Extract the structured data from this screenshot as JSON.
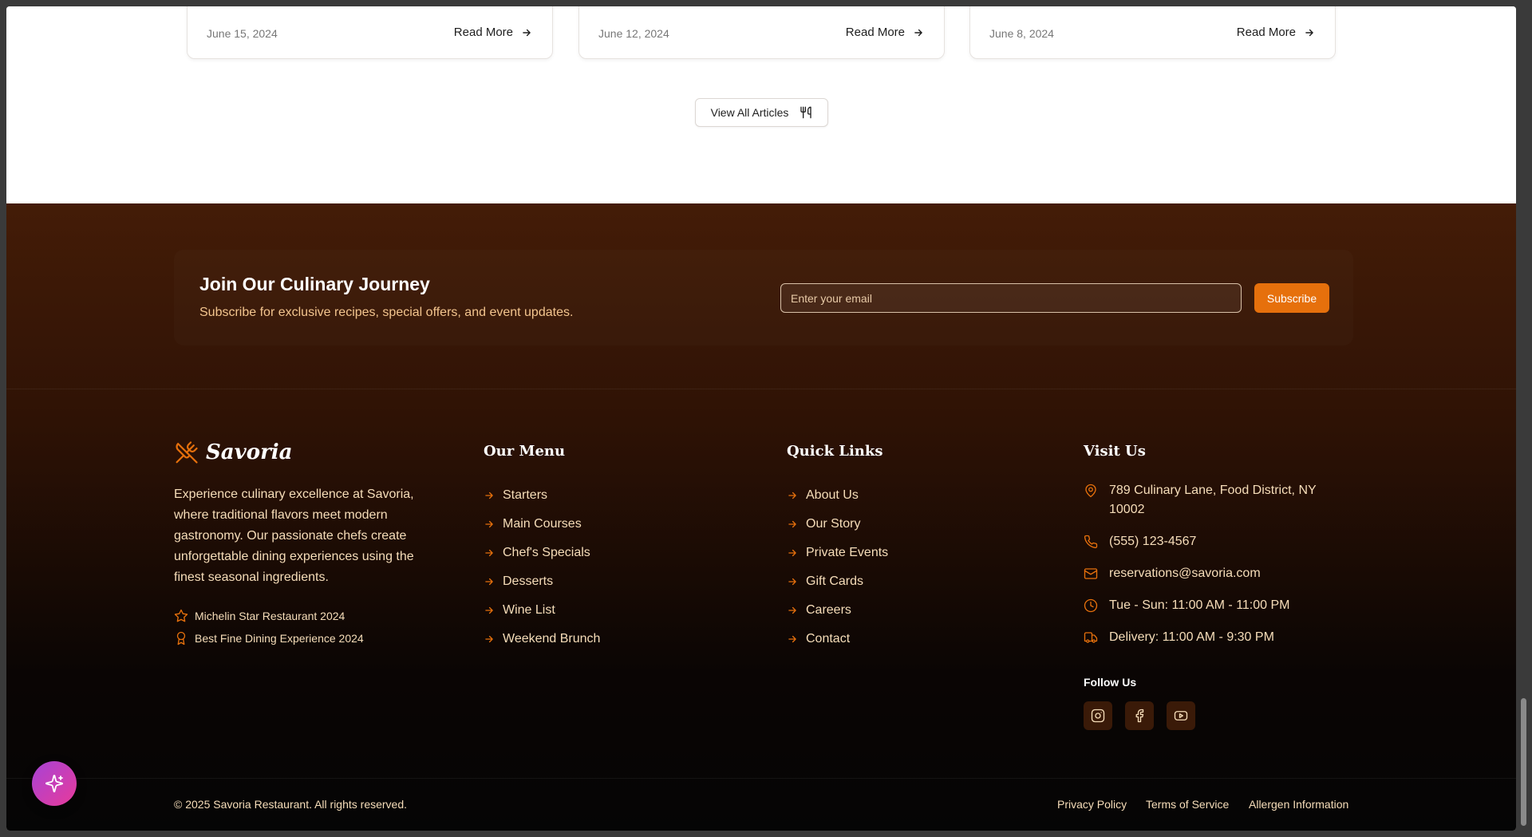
{
  "articles": {
    "cards": [
      {
        "date": "June 15, 2024",
        "read_more": "Read More"
      },
      {
        "date": "June 12, 2024",
        "read_more": "Read More"
      },
      {
        "date": "June 8, 2024",
        "read_more": "Read More"
      }
    ],
    "view_all_label": "View All Articles"
  },
  "newsletter": {
    "title": "Join Our Culinary Journey",
    "subtitle": "Subscribe for exclusive recipes, special offers, and event updates.",
    "email_placeholder": "Enter your email",
    "subscribe_label": "Subscribe"
  },
  "brand": {
    "name": "Savoria",
    "description": "Experience culinary excellence at Savoria, where traditional flavors meet modern gastronomy. Our passionate chefs create unforgettable dining experiences using the finest seasonal ingredients.",
    "awards": [
      {
        "icon": "star-icon",
        "label": "Michelin Star Restaurant 2024"
      },
      {
        "icon": "award-icon",
        "label": "Best Fine Dining Experience 2024"
      }
    ]
  },
  "menu": {
    "title": "Our Menu",
    "items": [
      "Starters",
      "Main Courses",
      "Chef's Specials",
      "Desserts",
      "Wine List",
      "Weekend Brunch"
    ]
  },
  "quick_links": {
    "title": "Quick Links",
    "items": [
      "About Us",
      "Our Story",
      "Private Events",
      "Gift Cards",
      "Careers",
      "Contact"
    ]
  },
  "visit": {
    "title": "Visit Us",
    "address": "789 Culinary Lane, Food District, NY 10002",
    "phone": "(555) 123-4567",
    "email": "reservations@savoria.com",
    "hours": "Tue - Sun: 11:00 AM - 11:00 PM",
    "delivery": "Delivery: 11:00 AM - 9:30 PM",
    "follow_label": "Follow Us",
    "social": [
      "instagram-icon",
      "facebook-icon",
      "youtube-icon"
    ]
  },
  "bottom": {
    "copyright": "© 2025 Savoria Restaurant. All rights reserved.",
    "links": [
      "Privacy Policy",
      "Terms of Service",
      "Allergen Information"
    ]
  },
  "colors": {
    "accent": "#e6700c",
    "footer_top": "#441c07",
    "footer_bottom": "#050505",
    "text_warm": "#f6ddb9",
    "fab_start": "#a743d6",
    "fab_end": "#e83a9a"
  }
}
